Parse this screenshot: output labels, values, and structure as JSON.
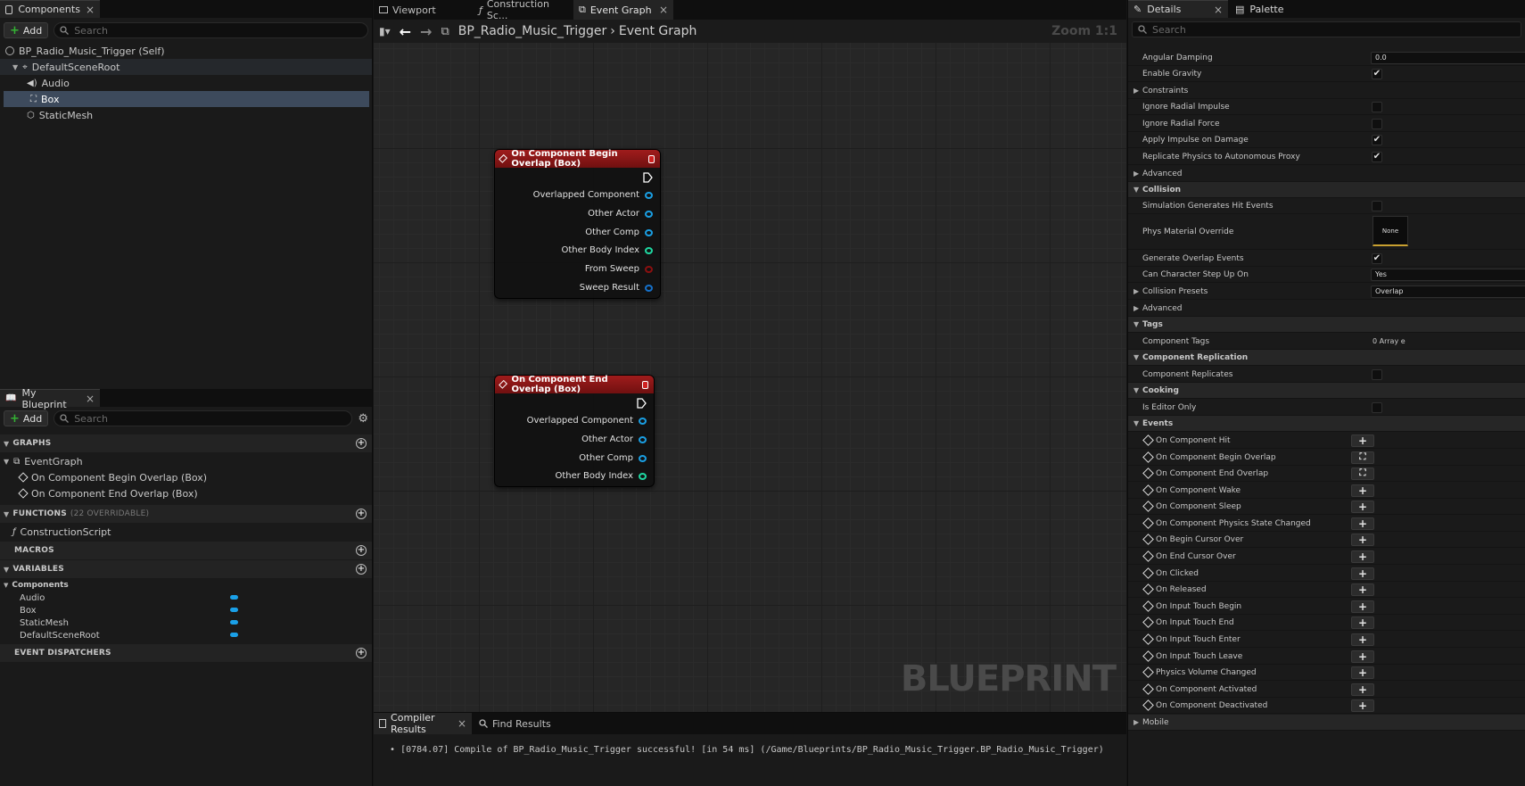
{
  "left": {
    "components_tab": "Components",
    "add_label": "Add",
    "search_placeholder": "Search",
    "tree": {
      "root": "BP_Radio_Music_Trigger (Self)",
      "scene_root": "DefaultSceneRoot",
      "children": [
        "Audio",
        "Box",
        "StaticMesh"
      ]
    },
    "blueprint_tab": "My Blueprint",
    "graphs_header": "GRAPHS",
    "event_graph": "EventGraph",
    "graph_events": [
      "On Component Begin Overlap (Box)",
      "On Component End Overlap (Box)"
    ],
    "functions_header": "FUNCTIONS",
    "functions_sub": "(22 OVERRIDABLE)",
    "construction_script": "ConstructionScript",
    "macros_header": "MACROS",
    "variables_header": "VARIABLES",
    "components_category": "Components",
    "variables": [
      "Audio",
      "Box",
      "StaticMesh",
      "DefaultSceneRoot"
    ],
    "dispatchers_header": "EVENT DISPATCHERS"
  },
  "center": {
    "tabs": [
      "Viewport",
      "Construction Sc...",
      "Event Graph"
    ],
    "breadcrumb_bp": "BP_Radio_Music_Trigger",
    "breadcrumb_graph": "Event Graph",
    "zoom": "Zoom 1:1",
    "watermark": "BLUEPRINT",
    "node_begin": {
      "title": "On Component Begin Overlap (Box)",
      "pins": [
        "Overlapped Component",
        "Other Actor",
        "Other Comp",
        "Other Body Index",
        "From Sweep",
        "Sweep Result"
      ]
    },
    "node_end": {
      "title": "On Component End Overlap (Box)",
      "pins": [
        "Overlapped Component",
        "Other Actor",
        "Other Comp",
        "Other Body Index"
      ]
    },
    "bottom_tabs": [
      "Compiler Results",
      "Find Results"
    ],
    "log": "[0784.07] Compile of BP_Radio_Music_Trigger successful! [in 54 ms] (/Game/Blueprints/BP_Radio_Music_Trigger.BP_Radio_Music_Trigger)"
  },
  "details": {
    "tab": "Details",
    "palette_tab": "Palette",
    "search_placeholder": "Search",
    "physics": {
      "angular_damping": "Angular Damping",
      "angular_damping_value": "0.0",
      "enable_gravity": "Enable Gravity",
      "constraints": "Constraints",
      "ignore_radial_impulse": "Ignore Radial Impulse",
      "ignore_radial_force": "Ignore Radial Force",
      "apply_impulse": "Apply Impulse on Damage",
      "replicate_physics": "Replicate Physics to Autonomous Proxy",
      "advanced": "Advanced"
    },
    "collision": {
      "header": "Collision",
      "sim_hit": "Simulation Generates Hit Events",
      "phys_material": "Phys Material Override",
      "phys_material_value": "None",
      "gen_overlap": "Generate Overlap Events",
      "can_step_up": "Can Character Step Up On",
      "can_step_up_value": "Yes",
      "presets": "Collision Presets",
      "presets_value": "Overlap",
      "advanced": "Advanced"
    },
    "tags": {
      "header": "Tags",
      "component_tags": "Component Tags",
      "component_tags_value": "0 Array e"
    },
    "replication": {
      "header": "Component Replication",
      "replicates": "Component Replicates"
    },
    "cooking": {
      "header": "Cooking",
      "editor_only": "Is Editor Only"
    },
    "events": {
      "header": "Events",
      "items": [
        "On Component Hit",
        "On Component Begin Overlap",
        "On Component End Overlap",
        "On Component Wake",
        "On Component Sleep",
        "On Component Physics State Changed",
        "On Begin Cursor Over",
        "On End Cursor Over",
        "On Clicked",
        "On Released",
        "On Input Touch Begin",
        "On Input Touch End",
        "On Input Touch Enter",
        "On Input Touch Leave",
        "Physics Volume Changed",
        "On Component Activated",
        "On Component Deactivated"
      ]
    },
    "mobile": "Mobile"
  }
}
